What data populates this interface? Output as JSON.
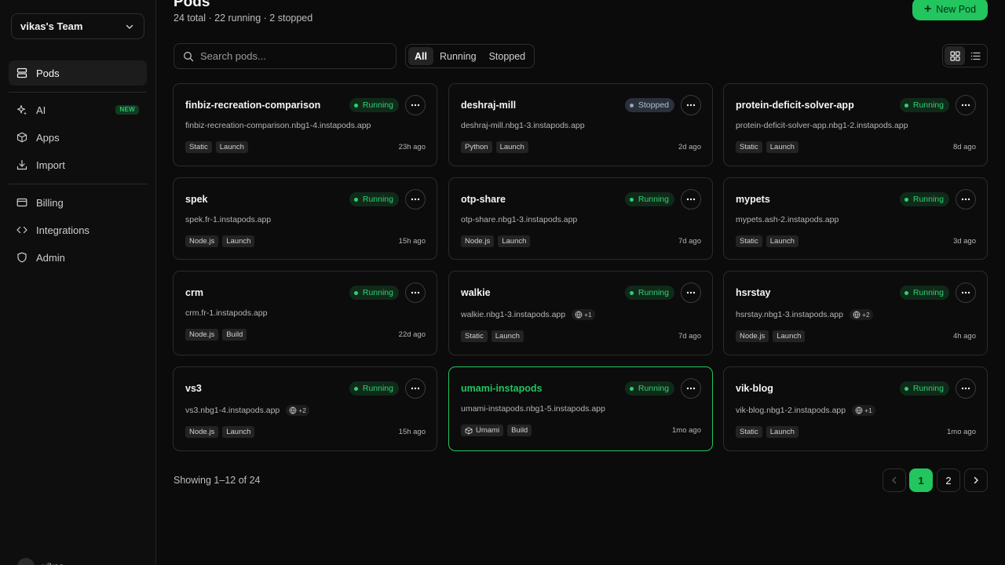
{
  "sidebar": {
    "team": "vikas's Team",
    "nav_main": [
      {
        "label": "Pods",
        "icon": "server-icon",
        "active": true
      }
    ],
    "nav_tools": [
      {
        "label": "AI",
        "icon": "sparkle-icon",
        "badge": "NEW"
      },
      {
        "label": "Apps",
        "icon": "box-icon"
      },
      {
        "label": "Import",
        "icon": "download-icon"
      }
    ],
    "nav_settings": [
      {
        "label": "Billing",
        "icon": "credit-card-icon"
      },
      {
        "label": "Integrations",
        "icon": "code-icon"
      },
      {
        "label": "Admin",
        "icon": "shield-icon"
      }
    ],
    "user_name": "vikas"
  },
  "header": {
    "title": "Pods",
    "subtitle": "24 total · 22 running · 2 stopped",
    "new_button": "New Pod"
  },
  "search": {
    "placeholder": "Search pods..."
  },
  "filters": [
    {
      "label": "All",
      "active": true
    },
    {
      "label": "Running",
      "active": false
    },
    {
      "label": "Stopped",
      "active": false
    }
  ],
  "view": {
    "active": "grid"
  },
  "colors": {
    "accent": "#22c55e",
    "running": "#2fd071",
    "stopped": "#b4bccb"
  },
  "pods": [
    {
      "name": "finbiz-recreation-comparison",
      "status": "Running",
      "url": "finbiz-recreation-comparison.nbg1-4.instapods.app",
      "extra": "",
      "tags": [
        "Static",
        "Launch"
      ],
      "ago": "23h ago"
    },
    {
      "name": "deshraj-mill",
      "status": "Stopped",
      "url": "deshraj-mill.nbg1-3.instapods.app",
      "extra": "",
      "tags": [
        "Python",
        "Launch"
      ],
      "ago": "2d ago"
    },
    {
      "name": "protein-deficit-solver-app",
      "status": "Running",
      "url": "protein-deficit-solver-app.nbg1-2.instapods.app",
      "extra": "",
      "tags": [
        "Static",
        "Launch"
      ],
      "ago": "8d ago"
    },
    {
      "name": "spek",
      "status": "Running",
      "url": "spek.fr-1.instapods.app",
      "extra": "",
      "tags": [
        "Node.js",
        "Launch"
      ],
      "ago": "15h ago"
    },
    {
      "name": "otp-share",
      "status": "Running",
      "url": "otp-share.nbg1-3.instapods.app",
      "extra": "",
      "tags": [
        "Node.js",
        "Launch"
      ],
      "ago": "7d ago"
    },
    {
      "name": "mypets",
      "status": "Running",
      "url": "mypets.ash-2.instapods.app",
      "extra": "",
      "tags": [
        "Static",
        "Launch"
      ],
      "ago": "3d ago"
    },
    {
      "name": "crm",
      "status": "Running",
      "url": "crm.fr-1.instapods.app",
      "extra": "",
      "tags": [
        "Node.js",
        "Build"
      ],
      "ago": "22d ago"
    },
    {
      "name": "walkie",
      "status": "Running",
      "url": "walkie.nbg1-3.instapods.app",
      "extra": "+1",
      "tags": [
        "Static",
        "Launch"
      ],
      "ago": "7d ago"
    },
    {
      "name": "hsrstay",
      "status": "Running",
      "url": "hsrstay.nbg1-3.instapods.app",
      "extra": "+2",
      "tags": [
        "Node.js",
        "Launch"
      ],
      "ago": "4h ago"
    },
    {
      "name": "vs3",
      "status": "Running",
      "url": "vs3.nbg1-4.instapods.app",
      "extra": "+2",
      "tags": [
        "Node.js",
        "Launch"
      ],
      "ago": "15h ago"
    },
    {
      "name": "umami-instapods",
      "status": "Running",
      "url": "umami-instapods.nbg1-5.instapods.app",
      "extra": "",
      "tags": [
        "Umami",
        "Build"
      ],
      "ago": "1mo ago",
      "highlight": true
    },
    {
      "name": "vik-blog",
      "status": "Running",
      "url": "vik-blog.nbg1-2.instapods.app",
      "extra": "+1",
      "tags": [
        "Static",
        "Launch"
      ],
      "ago": "1mo ago"
    }
  ],
  "pagination": {
    "showing": "Showing 1–12 of 24",
    "pages": [
      "1",
      "2"
    ],
    "current": "1"
  }
}
